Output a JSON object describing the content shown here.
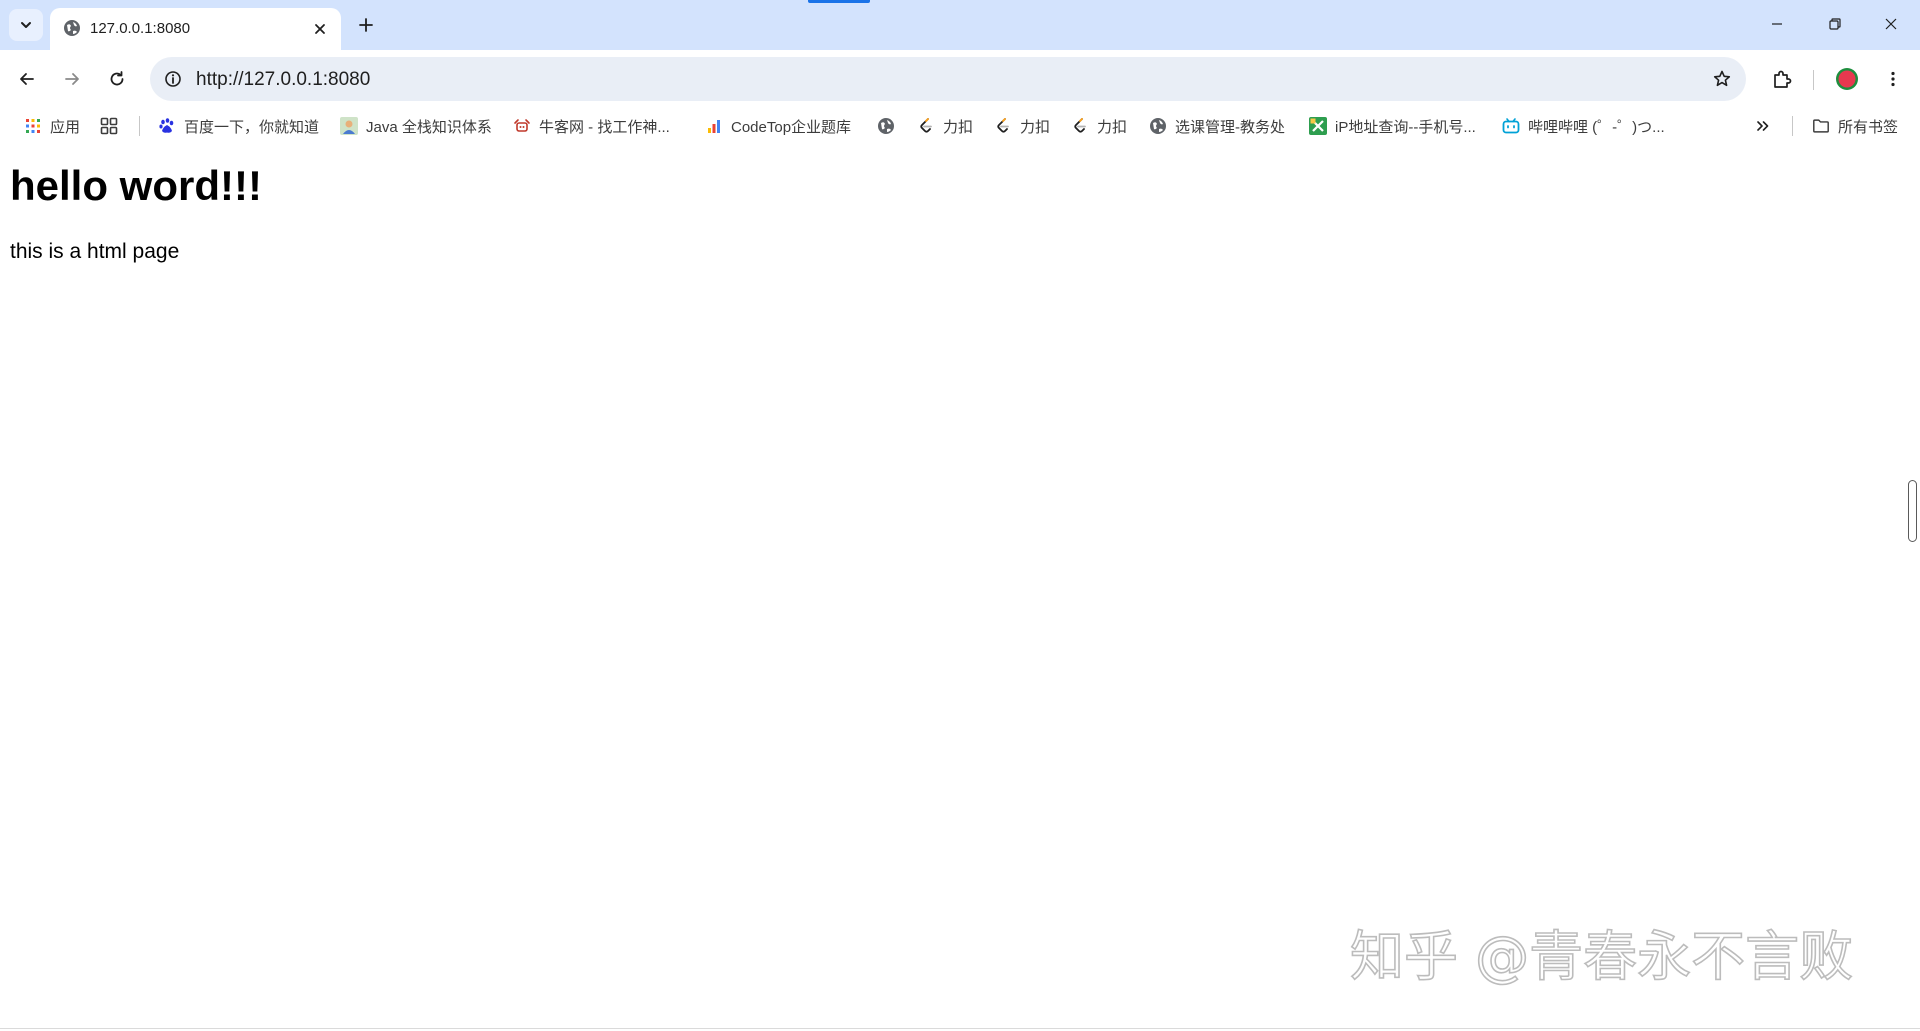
{
  "tabs": [
    {
      "title": "127.0.0.1:8080"
    }
  ],
  "toolbar": {
    "url": "http://127.0.0.1:8080"
  },
  "bookmarks": {
    "apps_label": "应用",
    "items": [
      {
        "label": "百度一下，你就知道",
        "icon": "baidu-paw"
      },
      {
        "label": "Java 全栈知识体系",
        "icon": "avatar"
      },
      {
        "label": "牛客网 - 找工作神...",
        "icon": "nowcoder"
      },
      {
        "label": "CodeTop企业题库",
        "icon": "bar-chart"
      },
      {
        "label": "",
        "icon": "globe"
      },
      {
        "label": "力扣",
        "icon": "leetcode"
      },
      {
        "label": "力扣",
        "icon": "leetcode"
      },
      {
        "label": "力扣",
        "icon": "leetcode"
      },
      {
        "label": "选课管理-教务处",
        "icon": "globe"
      },
      {
        "label": "iP地址查询--手机号...",
        "icon": "ip-tool"
      },
      {
        "label": "哔哩哔哩 (゜-゜)つ...",
        "icon": "bilibili"
      }
    ],
    "all_bookmarks_label": "所有书签"
  },
  "page": {
    "heading": "hello word!!!",
    "paragraph": "this is a html page"
  },
  "watermark": {
    "text": "知乎 @青春永不言败"
  },
  "colors": {
    "tabstrip_bg": "#d3e3fd",
    "omnibox_bg": "#e9eef6",
    "accent": "#1a73e8",
    "profile": "#e8384f"
  }
}
